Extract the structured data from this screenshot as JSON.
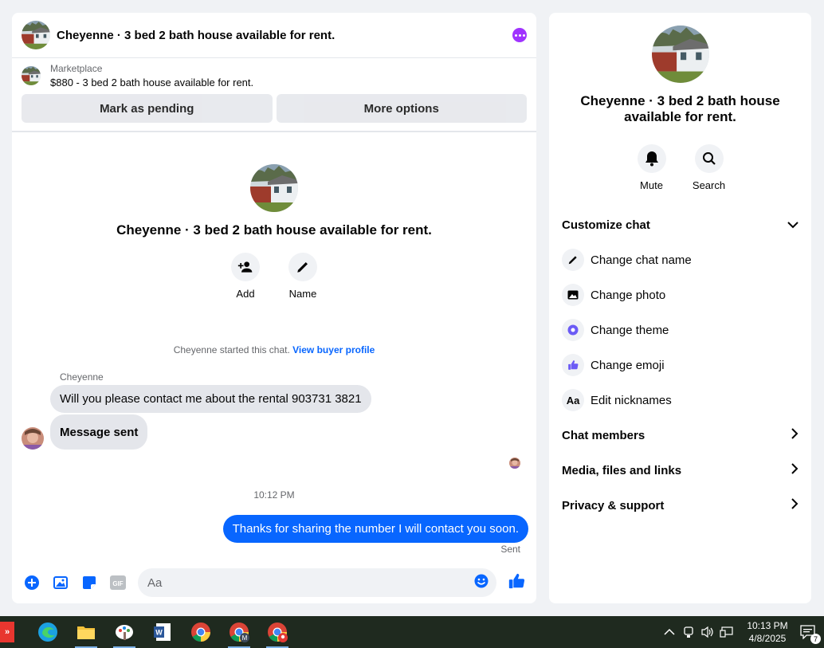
{
  "chat": {
    "title": "Cheyenne · 3 bed 2 bath house available for rent.",
    "marketplace_label": "Marketplace",
    "listing": "$880 - 3 bed 2 bath house available for rent.",
    "mark_pending": "Mark as pending",
    "more_options": "More options",
    "intro_name": "Cheyenne · 3 bed 2 bath house available for rent.",
    "add_label": "Add",
    "name_label": "Name",
    "started_text": "Cheyenne started this chat.",
    "buyer_profile_link": "View buyer profile",
    "sender_name": "Cheyenne",
    "messages_in": [
      "Will you please contact me about the rental  903731 3821",
      "Message sent"
    ],
    "timestamp": "10:12 PM",
    "message_out": "Thanks for sharing the number I will contact you soon.",
    "sent_status": "Sent",
    "composer_placeholder": "Aa"
  },
  "info": {
    "title": "Cheyenne · 3 bed 2 bath house available for rent.",
    "mute_label": "Mute",
    "search_label": "Search",
    "customize": "Customize chat",
    "change_name": "Change chat name",
    "change_photo": "Change photo",
    "change_theme": "Change theme",
    "change_emoji": "Change emoji",
    "nicknames_icon": "Aa",
    "edit_nicknames": "Edit nicknames",
    "members": "Chat members",
    "media": "Media, files and links",
    "privacy": "Privacy & support"
  },
  "taskbar": {
    "time": "10:13 PM",
    "date": "4/8/2025",
    "notification_count": "7"
  },
  "colors": {
    "accent": "#0866ff",
    "more_button": "#a033ff",
    "theme": "#6b5bf5"
  }
}
